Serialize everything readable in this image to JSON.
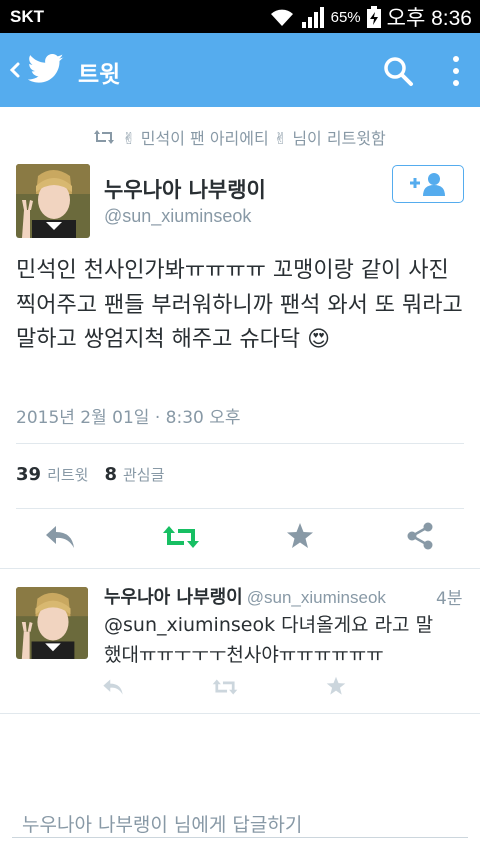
{
  "status_bar": {
    "carrier": "SKT",
    "battery": "65%",
    "time": "오후 8:36"
  },
  "app_bar": {
    "title": "트윗",
    "back_icon": "chevron-left-icon",
    "logo_icon": "twitter-bird-icon",
    "search_icon": "search-icon",
    "more_icon": "more-vertical-icon",
    "color": "#55acee"
  },
  "retweet_notice": {
    "emoji_left": "✌",
    "text_before": "민석이 팬 아리에티",
    "emoji_right": "✌",
    "text_after": "님이 리트윗함"
  },
  "tweet": {
    "author_name": "누우나아 나부랭이",
    "author_handle": "@sun_xiuminseok",
    "follow_icon": "add-user-icon",
    "text": "민석인 천사인가봐ㅠㅠㅠㅠ 꼬맹이랑 같이 사진찍어주고 팬들 부러워하니까 팬석 와서 또 뭐라고 말하고 쌍엄지척 해주고 슈다닥",
    "emoji": "😍",
    "date": "2015년 2월 01일 · 8:30 오후",
    "retweet_count": "39",
    "retweet_label": "리트윗",
    "like_count": "8",
    "like_label": "관심글"
  },
  "actions": [
    {
      "name": "reply-icon"
    },
    {
      "name": "retweet-icon"
    },
    {
      "name": "favorite-icon"
    },
    {
      "name": "share-icon"
    }
  ],
  "reply": {
    "author_name": "누우나아 나부랭이",
    "author_handle": "@sun_xiuminseok",
    "time": "4분",
    "text": "@sun_xiuminseok 다녀올게요 라고 말했대ㅠㅠㅜㅜㅜ천사야ㅠㅠㅠㅠㅠㅠ"
  },
  "reply_box": {
    "placeholder": "누우나아 나부랭이 님에게 답글하기"
  },
  "colors": {
    "accent": "#55acee",
    "retweet_green": "#17bf63",
    "muted": "#8899a6",
    "icon_gray": "#8899a6"
  }
}
